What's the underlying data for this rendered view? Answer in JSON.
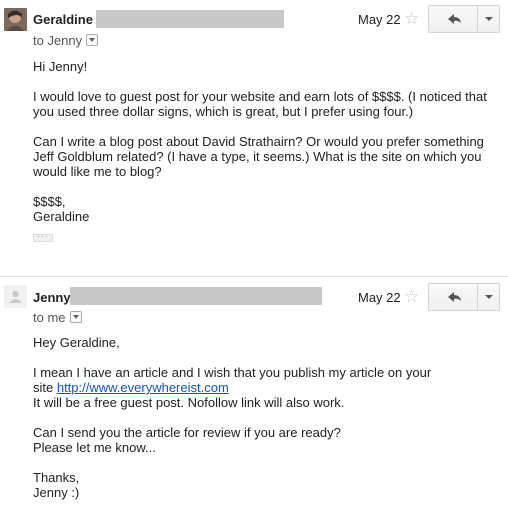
{
  "messages": [
    {
      "sender": "Geraldine",
      "date": "May 22",
      "to": "to Jenny",
      "body": [
        "Hi Jenny!",
        "",
        "I would love to guest post for your website and earn lots of $$$$. (I noticed that",
        "you used three dollar signs, which is great, but I prefer using four.)",
        "",
        "Can I write a blog post about David Strathairn? Or would you prefer something",
        "Jeff Goldblum related? (I have a type, it seems.) What is the site on which you",
        "would like me to blog?",
        "",
        "$$$$,",
        "Geraldine"
      ]
    },
    {
      "sender": "Jenny",
      "date": "May 22",
      "to": "to me",
      "body_before_link": [
        "Hey Geraldine,",
        "",
        "I mean I have an article and I wish that you publish my article on your"
      ],
      "link_prefix": "site ",
      "link": "http://www.everywhereist.com",
      "body_after_link": [
        "It will be a free guest post. Nofollow link will also work.",
        "",
        "Can I send you the article for review if you are ready?",
        "Please let me know...",
        "",
        "Thanks,",
        "Jenny :)"
      ]
    }
  ],
  "icons": {
    "star": "star-icon",
    "reply": "reply-arrow-icon",
    "more": "chevron-down-icon",
    "avatar_default": "person-icon"
  },
  "colors": {
    "link": "#1155cc",
    "redaction": "#c8c8c8",
    "star": "#c6c6c6"
  }
}
